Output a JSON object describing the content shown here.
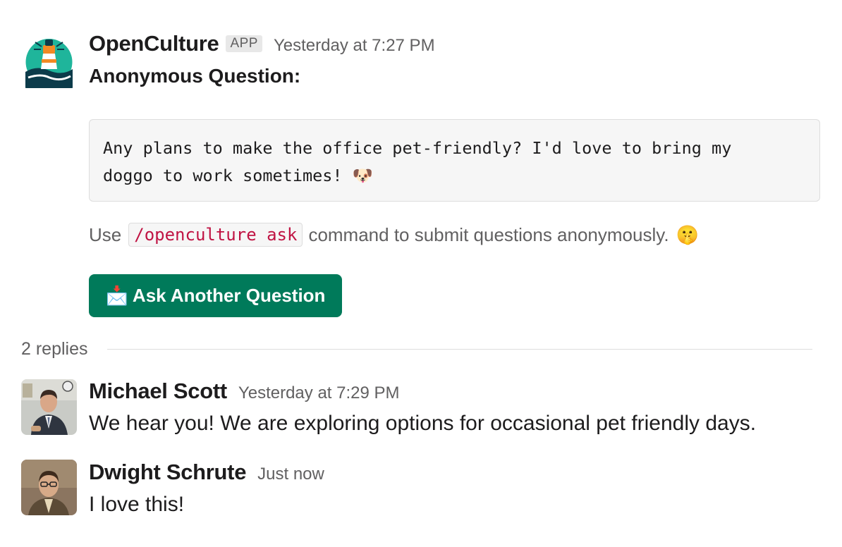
{
  "parent_message": {
    "sender": "OpenCulture",
    "badge": "APP",
    "timestamp": "Yesterday at 7:27 PM",
    "heading": "Anonymous Question:",
    "quote_lines": [
      "Any plans to make the office pet-friendly? I'd love to bring my",
      "doggo to work sometimes!"
    ],
    "quote_emoji": "🐶",
    "hint_prefix": "Use",
    "hint_command": "/openculture ask",
    "hint_suffix": "command to submit questions anonymously.",
    "hint_emoji": "🤫",
    "button_emoji": "📩",
    "button_label": "Ask Another Question"
  },
  "thread": {
    "replies_count": "2 replies",
    "replies": [
      {
        "sender": "Michael Scott",
        "timestamp": "Yesterday at 7:29 PM",
        "text": "We hear you! We are exploring options for occasional pet friendly days."
      },
      {
        "sender": "Dwight Schrute",
        "timestamp": "Just now",
        "text": "I love this!"
      }
    ]
  },
  "colors": {
    "button_bg": "#007a5a",
    "command_text": "#c01343",
    "muted_text": "#616061",
    "code_bg": "#f6f6f6"
  }
}
